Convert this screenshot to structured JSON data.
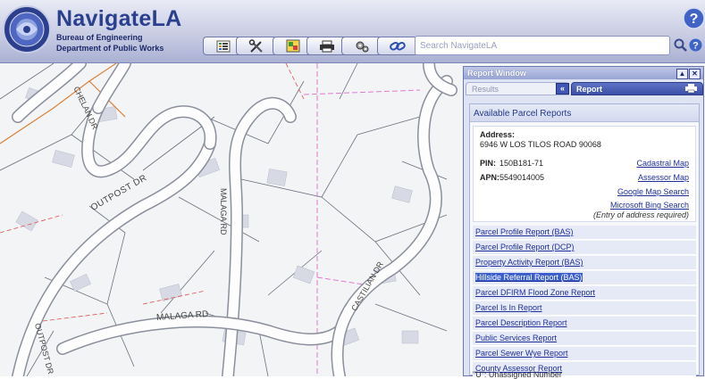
{
  "header": {
    "title": "NavigateLA",
    "subtitle_line1": "Bureau of Engineering",
    "subtitle_line2": "Department of Public Works",
    "search_placeholder": "Search NavigateLA"
  },
  "toolbar": {
    "icons": [
      "list-icon",
      "tools-icon",
      "layers-icon",
      "print-icon",
      "settings-icon",
      "link-icon"
    ]
  },
  "map": {
    "streets": [
      "OUTPOST DR",
      "CHELAN DR",
      "MALAGA RD",
      "MALAGA RD",
      "CASTILIAN DR",
      "OUTPOST DR"
    ]
  },
  "report_window": {
    "title": "Report Window",
    "tab_results": "Results",
    "tab_report": "Report",
    "panel_header": "Available Parcel Reports",
    "address_label": "Address:",
    "address_value": "6946 W LOS TILOS ROAD 90068",
    "pin_label": "PIN:",
    "pin_value": "150B181-71",
    "apn_label": "APN:",
    "apn_value": "5549014005",
    "links": {
      "cadastral": "Cadastral Map",
      "assessor": "Assessor Map",
      "google": "Google Map Search",
      "bing": "Microsoft Bing Search",
      "bing_note": "(Entry of address required)"
    },
    "reports": [
      "Parcel Profile Report (BAS)",
      "Parcel Profile Report (DCP)",
      "Property Activity Report (BAS)",
      "Hillside Referral Report (BAS)",
      "Parcel DFIRM Flood Zone Report",
      "Parcel Is In Report",
      "Parcel Description Report",
      "Public Services Report",
      "Parcel Sewer Wye Report",
      "County Assessor Report"
    ],
    "footnote": "\"U\": Unassigned Number"
  },
  "colors": {
    "header_blue": "#2a3f8e",
    "link_blue": "#1e2f9a",
    "highlight": "#3b5fcc"
  }
}
